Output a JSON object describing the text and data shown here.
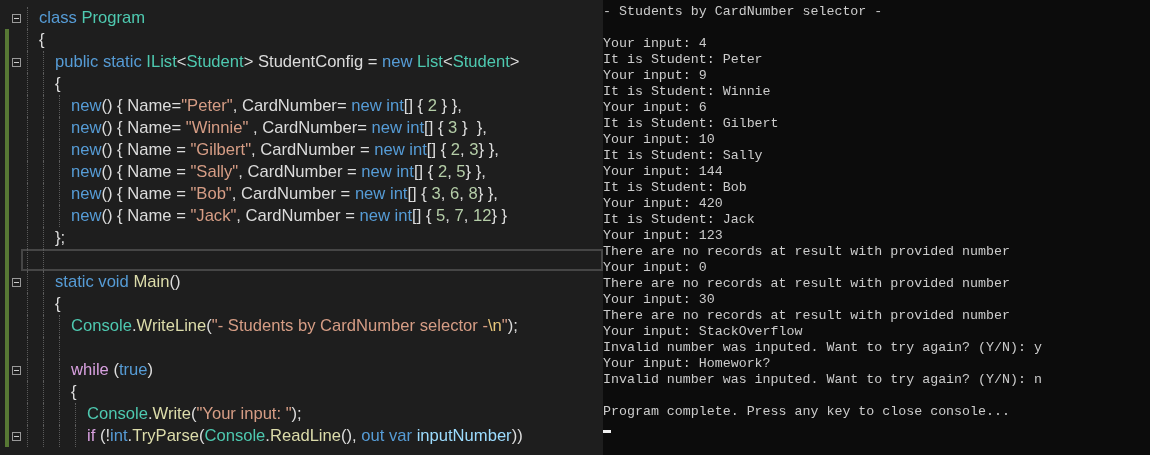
{
  "editor": {
    "code": [
      {
        "changed": false,
        "fold": true,
        "current": false,
        "tokens": [
          {
            "kind": "kw",
            "text": "class "
          },
          {
            "kind": "type",
            "text": "Program"
          }
        ]
      },
      {
        "changed": true,
        "fold": false,
        "current": false,
        "tokens": [
          {
            "kind": "plain",
            "text": "{"
          }
        ],
        "children": [
          {
            "changed": true,
            "fold": true,
            "current": false,
            "tokens": [
              {
                "kind": "kw",
                "text": "public static "
              },
              {
                "kind": "type",
                "text": "IList"
              },
              {
                "kind": "plain",
                "text": "<"
              },
              {
                "kind": "type",
                "text": "Student"
              },
              {
                "kind": "plain",
                "text": "> StudentConfig = "
              },
              {
                "kind": "kw",
                "text": "new "
              },
              {
                "kind": "type",
                "text": "List"
              },
              {
                "kind": "plain",
                "text": "<"
              },
              {
                "kind": "type",
                "text": "Student"
              },
              {
                "kind": "plain",
                "text": ">"
              }
            ]
          },
          {
            "changed": true,
            "fold": false,
            "current": false,
            "tokens": [
              {
                "kind": "plain",
                "text": "{"
              }
            ],
            "children": [
              {
                "changed": true,
                "fold": false,
                "current": false,
                "tokens": [
                  {
                    "kind": "kw",
                    "text": "new"
                  },
                  {
                    "kind": "plain",
                    "text": "() { Name="
                  },
                  {
                    "kind": "str",
                    "text": "\"Peter\""
                  },
                  {
                    "kind": "plain",
                    "text": ", CardNumber= "
                  },
                  {
                    "kind": "kw",
                    "text": "new int"
                  },
                  {
                    "kind": "plain",
                    "text": "[] { "
                  },
                  {
                    "kind": "num",
                    "text": "2"
                  },
                  {
                    "kind": "plain",
                    "text": " } },"
                  }
                ]
              },
              {
                "changed": true,
                "fold": false,
                "current": false,
                "tokens": [
                  {
                    "kind": "kw",
                    "text": "new"
                  },
                  {
                    "kind": "plain",
                    "text": "() { Name= "
                  },
                  {
                    "kind": "str",
                    "text": "\"Winnie\""
                  },
                  {
                    "kind": "plain",
                    "text": " , CardNumber= "
                  },
                  {
                    "kind": "kw",
                    "text": "new int"
                  },
                  {
                    "kind": "plain",
                    "text": "[] { "
                  },
                  {
                    "kind": "num",
                    "text": "3"
                  },
                  {
                    "kind": "plain",
                    "text": " }  },"
                  }
                ]
              },
              {
                "changed": true,
                "fold": false,
                "current": false,
                "tokens": [
                  {
                    "kind": "kw",
                    "text": "new"
                  },
                  {
                    "kind": "plain",
                    "text": "() { Name = "
                  },
                  {
                    "kind": "str",
                    "text": "\"Gilbert\""
                  },
                  {
                    "kind": "plain",
                    "text": ", CardNumber = "
                  },
                  {
                    "kind": "kw",
                    "text": "new int"
                  },
                  {
                    "kind": "plain",
                    "text": "[] { "
                  },
                  {
                    "kind": "num",
                    "text": "2"
                  },
                  {
                    "kind": "plain",
                    "text": ", "
                  },
                  {
                    "kind": "num",
                    "text": "3"
                  },
                  {
                    "kind": "plain",
                    "text": "} },"
                  }
                ]
              },
              {
                "changed": true,
                "fold": false,
                "current": false,
                "tokens": [
                  {
                    "kind": "kw",
                    "text": "new"
                  },
                  {
                    "kind": "plain",
                    "text": "() { Name = "
                  },
                  {
                    "kind": "str",
                    "text": "\"Sally\""
                  },
                  {
                    "kind": "plain",
                    "text": ", CardNumber = "
                  },
                  {
                    "kind": "kw",
                    "text": "new int"
                  },
                  {
                    "kind": "plain",
                    "text": "[] { "
                  },
                  {
                    "kind": "num",
                    "text": "2"
                  },
                  {
                    "kind": "plain",
                    "text": ", "
                  },
                  {
                    "kind": "num",
                    "text": "5"
                  },
                  {
                    "kind": "plain",
                    "text": "} },"
                  }
                ]
              },
              {
                "changed": true,
                "fold": false,
                "current": false,
                "tokens": [
                  {
                    "kind": "kw",
                    "text": "new"
                  },
                  {
                    "kind": "plain",
                    "text": "() { Name = "
                  },
                  {
                    "kind": "str",
                    "text": "\"Bob\""
                  },
                  {
                    "kind": "plain",
                    "text": ", CardNumber = "
                  },
                  {
                    "kind": "kw",
                    "text": "new int"
                  },
                  {
                    "kind": "plain",
                    "text": "[] { "
                  },
                  {
                    "kind": "num",
                    "text": "3"
                  },
                  {
                    "kind": "plain",
                    "text": ", "
                  },
                  {
                    "kind": "num",
                    "text": "6"
                  },
                  {
                    "kind": "plain",
                    "text": ", "
                  },
                  {
                    "kind": "num",
                    "text": "8"
                  },
                  {
                    "kind": "plain",
                    "text": "} },"
                  }
                ]
              },
              {
                "changed": true,
                "fold": false,
                "current": false,
                "tokens": [
                  {
                    "kind": "kw",
                    "text": "new"
                  },
                  {
                    "kind": "plain",
                    "text": "() { Name = "
                  },
                  {
                    "kind": "str",
                    "text": "\"Jack\""
                  },
                  {
                    "kind": "plain",
                    "text": ", CardNumber = "
                  },
                  {
                    "kind": "kw",
                    "text": "new int"
                  },
                  {
                    "kind": "plain",
                    "text": "[] { "
                  },
                  {
                    "kind": "num",
                    "text": "5"
                  },
                  {
                    "kind": "plain",
                    "text": ", "
                  },
                  {
                    "kind": "num",
                    "text": "7"
                  },
                  {
                    "kind": "plain",
                    "text": ", "
                  },
                  {
                    "kind": "num",
                    "text": "12"
                  },
                  {
                    "kind": "plain",
                    "text": "} }"
                  }
                ]
              }
            ]
          },
          {
            "changed": true,
            "fold": false,
            "current": false,
            "tokens": [
              {
                "kind": "plain",
                "text": "};"
              }
            ]
          },
          {
            "changed": true,
            "fold": false,
            "current": true
          },
          {
            "changed": true,
            "fold": true,
            "current": false,
            "tokens": [
              {
                "kind": "kw",
                "text": "static void "
              },
              {
                "kind": "method",
                "text": "Main"
              },
              {
                "kind": "plain",
                "text": "()"
              }
            ]
          },
          {
            "changed": true,
            "fold": false,
            "current": false,
            "tokens": [
              {
                "kind": "plain",
                "text": "{"
              }
            ],
            "children": [
              {
                "changed": true,
                "fold": false,
                "current": false,
                "tokens": [
                  {
                    "kind": "type",
                    "text": "Console"
                  },
                  {
                    "kind": "plain",
                    "text": "."
                  },
                  {
                    "kind": "method",
                    "text": "WriteLine"
                  },
                  {
                    "kind": "plain",
                    "text": "("
                  },
                  {
                    "kind": "str",
                    "text": "\"- Students by CardNumber selector -"
                  },
                  {
                    "kind": "esc",
                    "text": "\\n"
                  },
                  {
                    "kind": "str",
                    "text": "\""
                  },
                  {
                    "kind": "plain",
                    "text": ");"
                  }
                ]
              },
              {
                "changed": true,
                "fold": false,
                "current": false
              },
              {
                "changed": true,
                "fold": true,
                "current": false,
                "tokens": [
                  {
                    "kind": "ctrl",
                    "text": "while "
                  },
                  {
                    "kind": "plain",
                    "text": "("
                  },
                  {
                    "kind": "kw",
                    "text": "true"
                  },
                  {
                    "kind": "plain",
                    "text": ")"
                  }
                ]
              },
              {
                "changed": true,
                "fold": false,
                "current": false,
                "tokens": [
                  {
                    "kind": "plain",
                    "text": "{"
                  }
                ],
                "children": [
                  {
                    "changed": true,
                    "fold": false,
                    "current": false,
                    "tokens": [
                      {
                        "kind": "type",
                        "text": "Console"
                      },
                      {
                        "kind": "plain",
                        "text": "."
                      },
                      {
                        "kind": "method",
                        "text": "Write"
                      },
                      {
                        "kind": "plain",
                        "text": "("
                      },
                      {
                        "kind": "str",
                        "text": "\"Your input: \""
                      },
                      {
                        "kind": "plain",
                        "text": ");"
                      }
                    ]
                  },
                  {
                    "changed": true,
                    "fold": true,
                    "current": false,
                    "tokens": [
                      {
                        "kind": "ctrl",
                        "text": "if "
                      },
                      {
                        "kind": "plain",
                        "text": "(!"
                      },
                      {
                        "kind": "kw",
                        "text": "int"
                      },
                      {
                        "kind": "plain",
                        "text": "."
                      },
                      {
                        "kind": "method",
                        "text": "TryParse"
                      },
                      {
                        "kind": "plain",
                        "text": "("
                      },
                      {
                        "kind": "type",
                        "text": "Console"
                      },
                      {
                        "kind": "plain",
                        "text": "."
                      },
                      {
                        "kind": "method",
                        "text": "ReadLine"
                      },
                      {
                        "kind": "plain",
                        "text": "(), "
                      },
                      {
                        "kind": "kw",
                        "text": "out var "
                      },
                      {
                        "kind": "var",
                        "text": "inputNumber"
                      },
                      {
                        "kind": "plain",
                        "text": "))"
                      }
                    ]
                  }
                ]
              }
            ]
          }
        ]
      }
    ]
  },
  "console": {
    "paragraphs": [
      [
        "- Students by CardNumber selector -"
      ],
      [
        "Your input: 4",
        "It is Student: Peter",
        "Your input: 9",
        "It is Student: Winnie",
        "Your input: 6",
        "It is Student: Gilbert",
        "Your input: 10",
        "It is Student: Sally",
        "Your input: 144",
        "It is Student: Bob",
        "Your input: 420",
        "It is Student: Jack",
        "Your input: 123",
        "There are no records at result with provided number",
        "Your input: 0",
        "There are no records at result with provided number",
        "Your input: 30",
        "There are no records at result with provided number",
        "Your input: StackOverflow",
        "Invalid number was inputed. Want to try again? (Y/N): y",
        "Your input: Homework?",
        "Invalid number was inputed. Want to try again? (Y/N): n"
      ],
      [
        "Program complete. Press any key to close console..."
      ]
    ]
  }
}
